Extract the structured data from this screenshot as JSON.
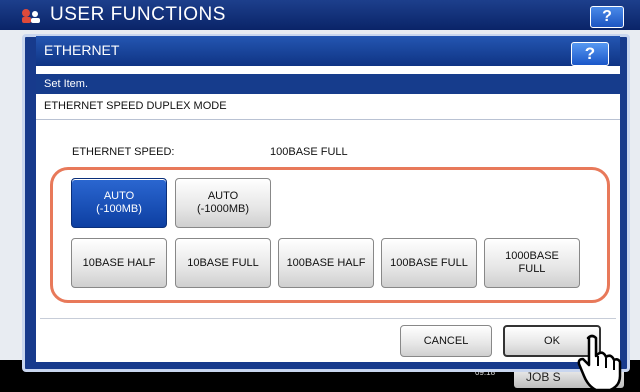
{
  "background": {
    "title": "USER FUNCTIONS",
    "help_label": "?",
    "time_top": "",
    "time_bottom": "09:18",
    "job_label": "JOB S"
  },
  "dialog": {
    "title": "ETHERNET",
    "help_label": "?",
    "set_item": "Set Item.",
    "mode_title": "ETHERNET SPEED DUPLEX MODE",
    "speed_label": "ETHERNET SPEED:",
    "speed_value": "100BASE FULL",
    "options_row1": [
      {
        "label": "AUTO\n(-100MB)",
        "selected": true
      },
      {
        "label": "AUTO\n(-1000MB)",
        "selected": false
      }
    ],
    "options_row2": [
      {
        "label": "10BASE HALF",
        "selected": false
      },
      {
        "label": "10BASE FULL",
        "selected": false
      },
      {
        "label": "100BASE HALF",
        "selected": false
      },
      {
        "label": "100BASE FULL",
        "selected": false
      },
      {
        "label": "1000BASE\nFULL",
        "selected": false
      }
    ],
    "cancel_label": "CANCEL",
    "ok_label": "OK"
  },
  "colors": {
    "header_blue": "#0f3484",
    "selected_blue": "#1a52bd",
    "highlight_orange": "#e8795a"
  }
}
